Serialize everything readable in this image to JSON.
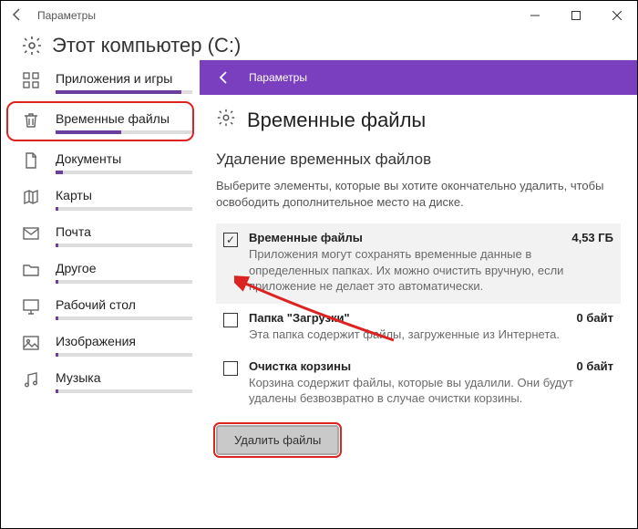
{
  "titlebar": {
    "title": "Параметры"
  },
  "header": {
    "title": "Этот компьютер (C:)"
  },
  "crumb": {
    "title": "Параметры"
  },
  "sidebar": {
    "items": [
      {
        "label": "Приложения и игры",
        "fill": 92
      },
      {
        "label": "Временные файлы",
        "fill": 48
      },
      {
        "label": "Документы",
        "fill": 5
      },
      {
        "label": "Карты",
        "fill": 2
      },
      {
        "label": "Почта",
        "fill": 2
      },
      {
        "label": "Другое",
        "fill": 2
      },
      {
        "label": "Рабочий стол",
        "fill": 2
      },
      {
        "label": "Изображения",
        "fill": 2
      },
      {
        "label": "Музыка",
        "fill": 2
      }
    ]
  },
  "panel": {
    "title": "Временные файлы",
    "subheading": "Удаление временных файлов",
    "lead": "Выберите элементы, которые вы хотите окончательно удалить, чтобы освободить дополнительное место на диске.",
    "items": [
      {
        "title": "Временные файлы",
        "size": "4,53 ГБ",
        "desc": "Приложения могут сохранять временные данные в определенных папках. Их можно очистить вручную, если приложение не делает это автоматически.",
        "checked": true
      },
      {
        "title": "Папка \"Загрузки\"",
        "size": "0 байт",
        "desc": "Эта папка содержит файлы, загруженные из Интернета.",
        "checked": false
      },
      {
        "title": "Очистка корзины",
        "size": "0 байт",
        "desc": "Корзина содержит файлы, которые вы удалили. Они будут удалены безвозвратно в случае очистки корзины.",
        "checked": false
      }
    ],
    "delete_label": "Удалить файлы"
  }
}
